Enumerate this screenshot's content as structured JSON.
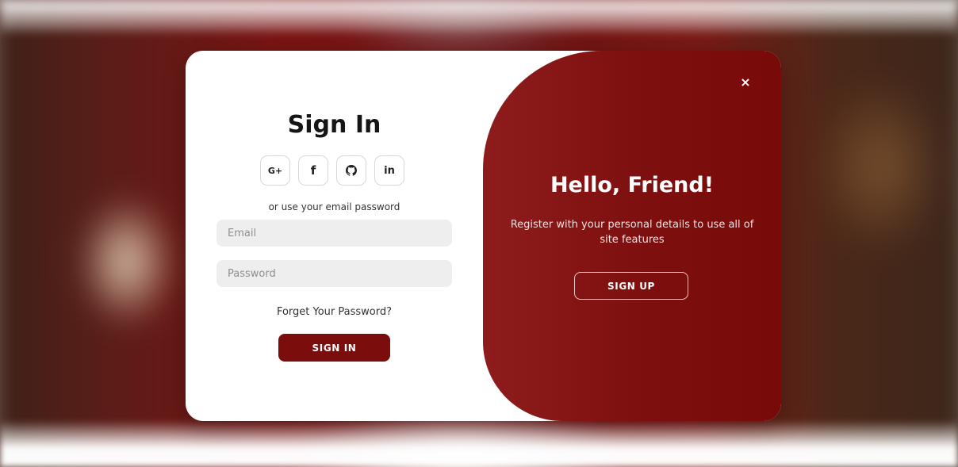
{
  "signin": {
    "title": "Sign In",
    "social_buttons": [
      {
        "label": "G+",
        "icon": "google-plus-icon"
      },
      {
        "label": "f",
        "icon": "facebook-icon"
      },
      {
        "label": "",
        "icon": "github-icon"
      },
      {
        "label": "in",
        "icon": "linkedin-icon"
      }
    ],
    "alt_text": "or use your email password",
    "email_placeholder": "Email",
    "password_placeholder": "Password",
    "forgot_label": "Forget Your Password?",
    "button_label": "SIGN IN"
  },
  "panel": {
    "close_label": "×",
    "title": "Hello, Friend!",
    "text": "Register with your personal details to use all of site features",
    "button_label": "SIGN UP"
  },
  "colors": {
    "primary": "#7c0d0d",
    "panel_gradient_start": "#8e1c1c",
    "panel_gradient_end": "#780a0a",
    "input_background": "#eeeeee"
  }
}
